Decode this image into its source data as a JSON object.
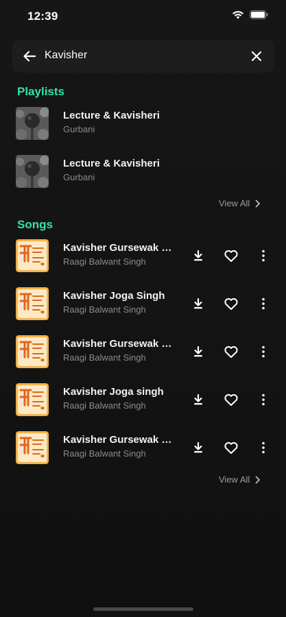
{
  "status": {
    "time": "12:39"
  },
  "search": {
    "query": "Kavisher"
  },
  "playlists": {
    "heading": "Playlists",
    "items": [
      {
        "title": "Lecture & Kavisheri",
        "subtitle": "Gurbani"
      },
      {
        "title": "Lecture & Kavisheri",
        "subtitle": "Gurbani"
      }
    ],
    "view_all": "View All"
  },
  "songs": {
    "heading": "Songs",
    "items": [
      {
        "title": "Kavisher Gursewak Singh",
        "artist": "Raagi Balwant Singh"
      },
      {
        "title": "Kavisher Joga Singh",
        "artist": "Raagi Balwant Singh"
      },
      {
        "title": "Kavisher Gursewak Singh",
        "artist": "Raagi Balwant Singh"
      },
      {
        "title": "Kavisher Joga singh",
        "artist": "Raagi Balwant Singh"
      },
      {
        "title": "Kavisher Gursewak Singh",
        "artist": "Raagi Balwant Singh"
      }
    ],
    "view_all": "View All"
  },
  "icons": {
    "back": "arrow-left-icon",
    "close": "close-icon",
    "download": "download-icon",
    "like": "heart-icon",
    "more": "more-vertical-icon",
    "chevron": "chevron-right-icon"
  },
  "colors": {
    "accent": "#2ee6a8",
    "background": "#141414",
    "surface": "#1d1d1d",
    "muted": "#8c8c8c"
  }
}
